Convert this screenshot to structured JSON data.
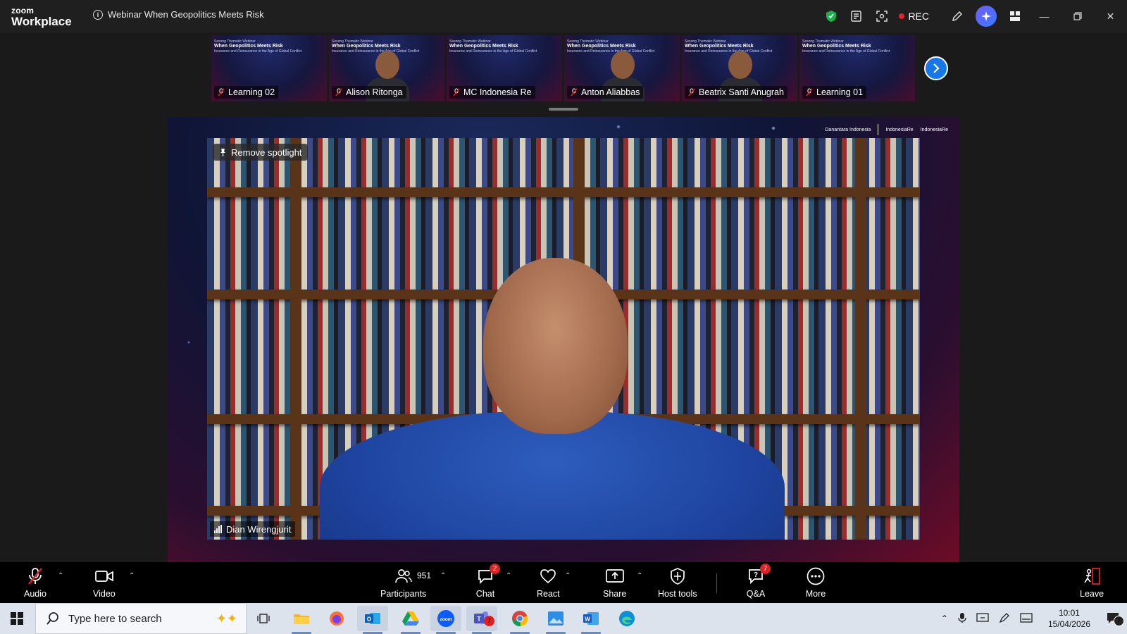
{
  "app": {
    "brand_line1": "zoom",
    "brand_line2": "Workplace",
    "meeting_title": "Webinar When Geopolitics Meets Risk"
  },
  "titlebar": {
    "rec_label": "REC"
  },
  "thumbnails": [
    {
      "name": "Learning 02",
      "has_face": false
    },
    {
      "name": "Alison Ritonga",
      "has_face": true
    },
    {
      "name": "MC Indonesia Re",
      "has_face": false
    },
    {
      "name": "Anton Aliabbas",
      "has_face": true
    },
    {
      "name": "Beatrix Santi Anugrah",
      "has_face": true
    },
    {
      "name": "Learning 01",
      "has_face": false
    }
  ],
  "thumb_slide": {
    "kicker": "Sesong Thematic Webinar",
    "headline": "When Geopolitics Meets Risk",
    "sub": "Insurance and Reinsurance in the Age of Global Conflict"
  },
  "stage": {
    "spotlight_label": "Remove spotlight",
    "speaker_name": "Dian Wirengjurit",
    "sponsor_1": "Danantara Indonesia",
    "sponsor_2": "IndonesiaRe",
    "sponsor_3": "IndonesiaRe"
  },
  "toolbar": {
    "audio": "Audio",
    "video": "Video",
    "participants": "Participants",
    "participants_count": "951",
    "chat": "Chat",
    "chat_badge": "2",
    "react": "React",
    "share": "Share",
    "host_tools": "Host tools",
    "qa": "Q&A",
    "qa_badge": "7",
    "more": "More",
    "leave": "Leave"
  },
  "taskbar": {
    "search_placeholder": "Type here to search",
    "teams_badge": "7",
    "time": "10:01",
    "date": "15/04/2026",
    "notif_badge": "7"
  },
  "colors": {
    "accent_blue": "#1776e8",
    "rec_red": "#e0242e",
    "badge_red": "#e02020",
    "shield_green": "#18b24b"
  }
}
